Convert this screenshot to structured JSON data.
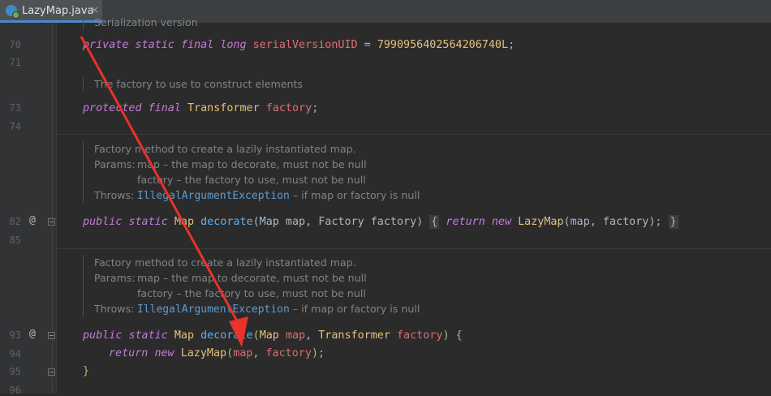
{
  "tab": {
    "label": "LazyMap.java",
    "close": "×"
  },
  "gutter": {
    "lines": [
      "70",
      "71",
      "73",
      "74",
      "82",
      "85",
      "93",
      "94",
      "95",
      "96"
    ],
    "override_marks": [
      "@",
      "@"
    ]
  },
  "doc_top": {
    "text": "Serialization version"
  },
  "code": {
    "l70": {
      "mod1": "private",
      "mod2": "static",
      "mod3": "final",
      "type": "long",
      "name": "serialVersionUID",
      "op": " = ",
      "value": "7990956402564206740L",
      "end": ";"
    },
    "l73": {
      "mod1": "protected",
      "mod2": "final",
      "type": "Transformer",
      "name": "factory",
      "end": ";"
    },
    "l82": {
      "mod1": "public",
      "mod2": "static",
      "ret": "Map",
      "method": "decorate",
      "params": "(Map map, Factory factory)",
      "body_open": "{",
      "kw_return": "return",
      "kw_new": "new",
      "ctor": "LazyMap",
      "args": "(map, factory);",
      "body_close": "}"
    },
    "l93": {
      "mod1": "public",
      "mod2": "static",
      "ret": "Map",
      "method": "decorate",
      "p_open": "(",
      "p1type": "Map",
      "p1": "map",
      "comma": ", ",
      "p2type": "Transformer",
      "p2": "factory",
      "p_close": ")",
      "brace": "{"
    },
    "l94": {
      "kw_return": "return",
      "kw_new": "new",
      "ctor": "LazyMap",
      "args_open": "(",
      "a1": "map",
      "comma": ", ",
      "a2": "factory",
      "args_close": ");"
    },
    "l95": {
      "brace": "}"
    }
  },
  "doc_factory": {
    "text": "The factory to use to construct elements"
  },
  "doc_decorate1": {
    "summary": "Factory method to create a lazily instantiated map.",
    "params_label": "Params:",
    "param1": "map – the map to decorate, must not be null",
    "param2": "factory – the factory to use, must not be null",
    "throws_label": "Throws:",
    "exception": "IllegalArgumentException",
    "throws_desc": " – if map or factory is null"
  },
  "doc_decorate2": {
    "summary": "Factory method to create a lazily instantiated map.",
    "params_label": "Params:",
    "param1": "map – the map to decorate, must not be null",
    "param2": "factory – the factory to use, must not be null",
    "throws_label": "Throws:",
    "exception": "IllegalArgumentException",
    "throws_desc": " – if map or factory is null"
  },
  "annotation": {
    "color": "#e8322b"
  }
}
